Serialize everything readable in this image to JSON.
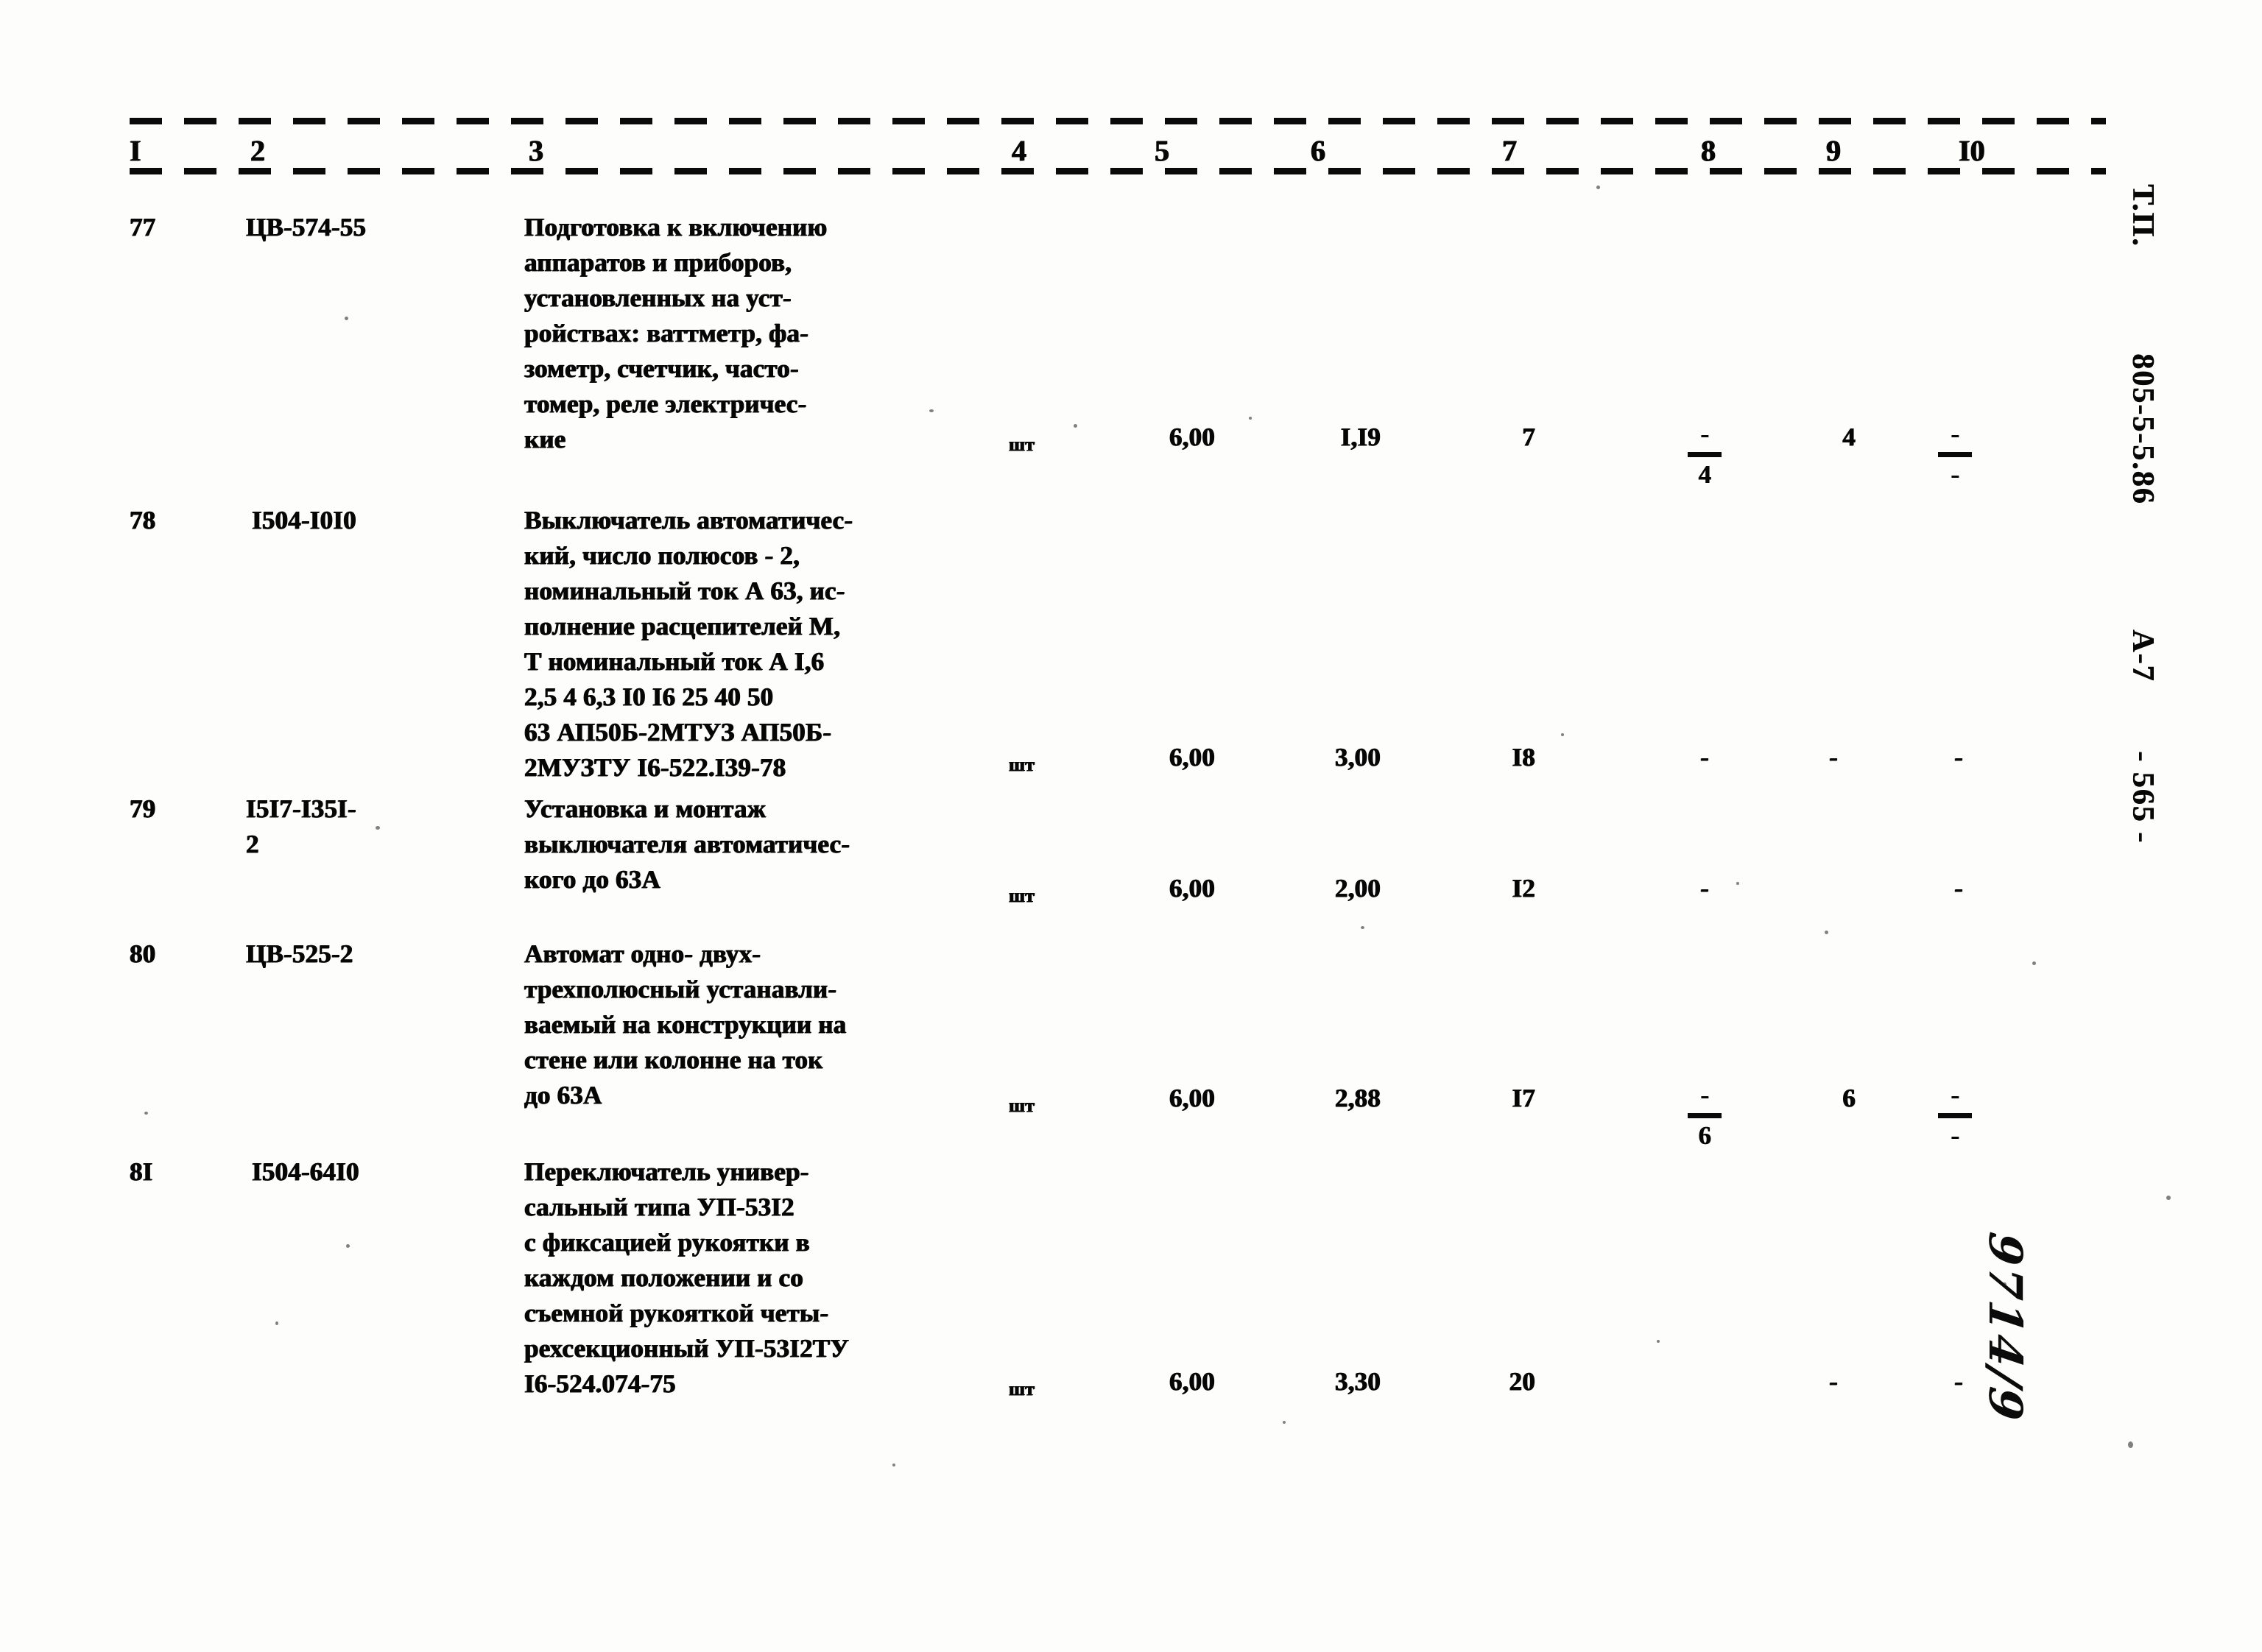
{
  "document": {
    "title": "Т.П. 805-5-5.86 А-7 - 565 -",
    "side_marks": [
      "Т.П.",
      "805-5-5.86",
      "А-7",
      "- 565 -"
    ],
    "hand_annotation": "9714/9"
  },
  "table": {
    "column_headers": [
      "I",
      "2",
      "3",
      "4",
      "5",
      "6",
      "7",
      "8",
      "9",
      "I0"
    ],
    "rows": [
      {
        "num": "77",
        "code": "ЦВ-574-55",
        "description": "Подготовка к включению\nаппаратов и приборов,\nустановленных на уст-\nройствах: ваттметр, фа-\nзометр, счетчик, часто-\nтомер, реле электричес-\nкие",
        "unit": "шт",
        "col5": "6,00",
        "col6": "I,I9",
        "col7": "7",
        "col8_top": "-",
        "col8_bot": "4",
        "col9": "4",
        "col10_top": "-",
        "col10_bot": "-"
      },
      {
        "num": "78",
        "code": "I504-I0I0",
        "description": "Выключатель автоматичес-\nкий, число полюсов - 2,\nноминальный ток А 63, ис-\nполнение расцепителей М,\nТ номинальный ток А I,6\n2,5 4 6,3 I0 I6 25 40 50\n63  АП50Б-2МТУЗ АП50Б-\n2МУЗТУ I6-522.I39-78",
        "unit": "шт",
        "col5": "6,00",
        "col6": "3,00",
        "col7": "I8",
        "col8_top": "-",
        "col8_bot": "",
        "col9": "-",
        "col10_top": "-",
        "col10_bot": ""
      },
      {
        "num": "79",
        "code": "I5I7-I35I-\n2",
        "description": "Установка и монтаж\nвыключателя автоматичес-\nкого до 63А",
        "unit": "шт",
        "col5": "6,00",
        "col6": "2,00",
        "col7": "I2",
        "col8_top": "-",
        "col8_bot": "",
        "col9": "",
        "col10_top": "-",
        "col10_bot": ""
      },
      {
        "num": "80",
        "code": "ЦВ-525-2",
        "description": "Автомат одно- двух-\nтрехполюсный устанавли-\nваемый на конструкции на\nстене или колонне на ток\nдо 63А",
        "unit": "шт",
        "col5": "6,00",
        "col6": "2,88",
        "col7": "I7",
        "col8_top": "-",
        "col8_bot": "6",
        "col9": "6",
        "col10_top": "-",
        "col10_bot": "-"
      },
      {
        "num": "8I",
        "code": "I504-64I0",
        "description": "Переключатель универ-\nсальный типа УП-53I2\nс фиксацией рукоятки в\nкаждом положении и со\nсъемной рукояткой четы-\nрехсекционный УП-53I2ТУ\nI6-524.074-75",
        "unit": "шт",
        "col5": "6,00",
        "col6": "3,30",
        "col7": "20",
        "col8_top": "",
        "col8_bot": "",
        "col9": "-",
        "col10_top": "-",
        "col10_bot": ""
      }
    ]
  }
}
